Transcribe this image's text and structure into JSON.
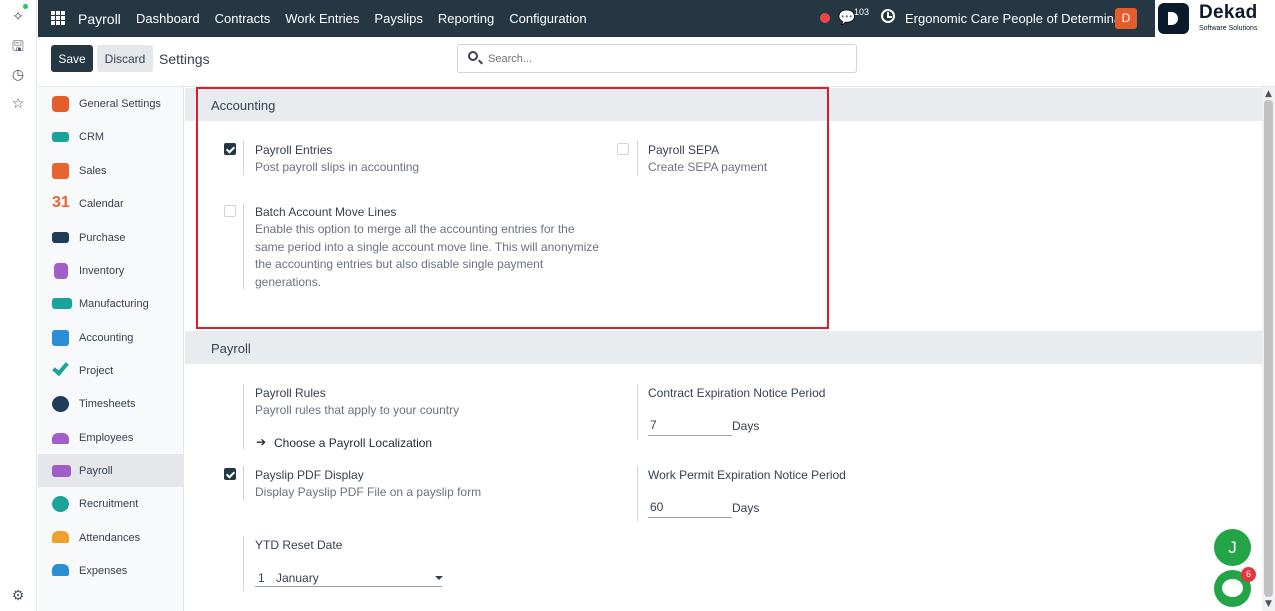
{
  "rail": {
    "icons": [
      "sparkle-icon",
      "inbox-icon",
      "history-icon",
      "star-icon",
      "gear-icon"
    ]
  },
  "topbar": {
    "app_name": "Payroll",
    "menu": [
      "Dashboard",
      "Contracts",
      "Work Entries",
      "Payslips",
      "Reporting",
      "Configuration"
    ],
    "chat_count": "103",
    "company": "Ergonomic Care People of Determina...",
    "avatar_letter": "D",
    "colors": {
      "bar": "#243742",
      "avatar": "#e45d2d",
      "record": "#ef4444"
    }
  },
  "brand": {
    "name": "Dekad",
    "tagline": "Software Solutions"
  },
  "control": {
    "save_label": "Save",
    "discard_label": "Discard",
    "breadcrumb": "Settings",
    "search_placeholder": "Search..."
  },
  "sidebar": {
    "items": [
      {
        "label": "General Settings",
        "icon": "general-settings-icon",
        "color": "#e45d2d"
      },
      {
        "label": "CRM",
        "icon": "crm-icon",
        "color": "#1aa39a"
      },
      {
        "label": "Sales",
        "icon": "sales-icon",
        "color": "#e9632e"
      },
      {
        "label": "Calendar",
        "icon": "calendar-icon",
        "color": "#e9632e"
      },
      {
        "label": "Purchase",
        "icon": "purchase-icon",
        "color": "#1f3c5a"
      },
      {
        "label": "Inventory",
        "icon": "inventory-icon",
        "color": "#a05ec6"
      },
      {
        "label": "Manufacturing",
        "icon": "manufacturing-icon",
        "color": "#1aa39a"
      },
      {
        "label": "Accounting",
        "icon": "accounting-icon",
        "color": "#2b8fd6"
      },
      {
        "label": "Project",
        "icon": "project-icon",
        "color": "#1aa39a"
      },
      {
        "label": "Timesheets",
        "icon": "timesheets-icon",
        "color": "#1f3c5a"
      },
      {
        "label": "Employees",
        "icon": "employees-icon",
        "color": "#a05ec6"
      },
      {
        "label": "Payroll",
        "icon": "payroll-icon",
        "color": "#a05ec6",
        "active": true
      },
      {
        "label": "Recruitment",
        "icon": "recruitment-icon",
        "color": "#1aa39a"
      },
      {
        "label": "Attendances",
        "icon": "attendances-icon",
        "color": "#f0a12b"
      },
      {
        "label": "Expenses",
        "icon": "expenses-icon",
        "color": "#2b8fd6"
      }
    ]
  },
  "accounting": {
    "title": "Accounting",
    "payroll_entries": {
      "title": "Payroll Entries",
      "desc": "Post payroll slips in accounting",
      "checked": true
    },
    "payroll_sepa": {
      "title": "Payroll SEPA",
      "desc": "Create SEPA payment",
      "checked": false
    },
    "batch_move": {
      "title": "Batch Account Move Lines",
      "desc": "Enable this option to merge all the accounting entries for the same period into a single account move line. This will anonymize the accounting entries but also disable single payment generations.",
      "checked": false
    },
    "highlight_color": "#d81e2b"
  },
  "payroll": {
    "title": "Payroll",
    "rules": {
      "title": "Payroll Rules",
      "desc": "Payroll rules that apply to your country",
      "link": "Choose a Payroll Localization"
    },
    "contract_notice": {
      "title": "Contract Expiration Notice Period",
      "value": "7",
      "unit": "Days"
    },
    "payslip_pdf": {
      "title": "Payslip PDF Display",
      "desc": "Display Payslip PDF File on a payslip form",
      "checked": true
    },
    "permit_notice": {
      "title": "Work Permit Expiration Notice Period",
      "value": "60",
      "unit": "Days"
    },
    "ytd": {
      "title": "YTD Reset Date",
      "day": "1",
      "month": "January"
    }
  },
  "floating": {
    "user_letter": "J",
    "helper_badge": "6"
  }
}
